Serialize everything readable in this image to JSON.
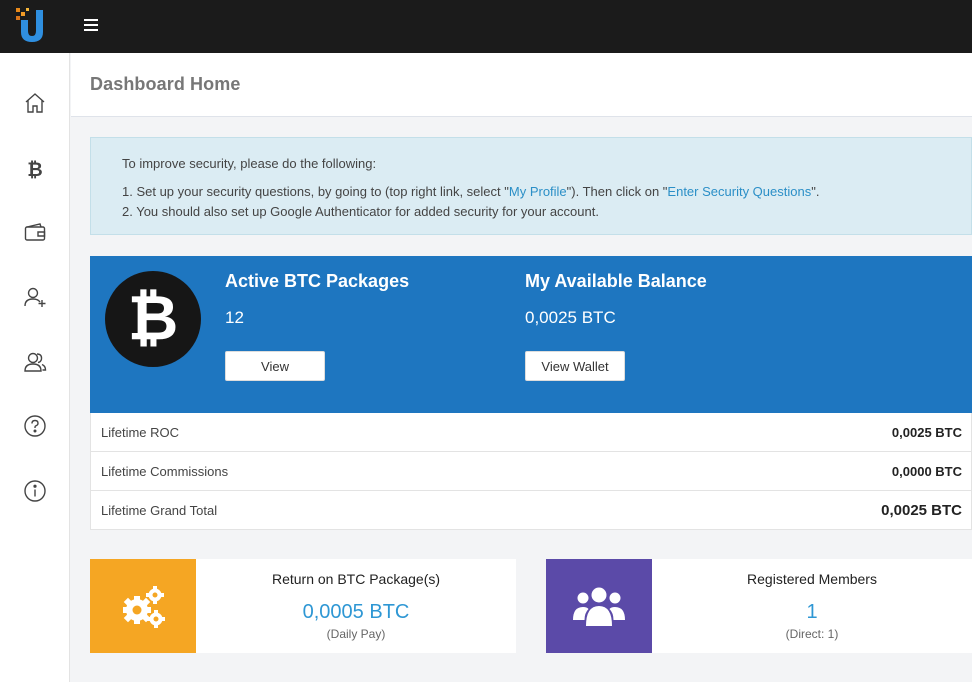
{
  "header": {
    "menu_icon": "hamburger-icon",
    "logo_icon": "u-logo-icon"
  },
  "sidebar": {
    "items": [
      {
        "name": "home",
        "icon": "home-icon"
      },
      {
        "name": "bitcoin",
        "icon": "bitcoin-icon"
      },
      {
        "name": "wallet",
        "icon": "wallet-icon"
      },
      {
        "name": "add-user",
        "icon": "add-user-icon"
      },
      {
        "name": "users",
        "icon": "users-icon"
      },
      {
        "name": "help",
        "icon": "help-icon"
      },
      {
        "name": "info",
        "icon": "info-icon"
      }
    ]
  },
  "page": {
    "title": "Dashboard Home"
  },
  "alert": {
    "intro": "To improve security, please do the following:",
    "line1_a": "1. Set up your security questions, by going to (top right link, select \"",
    "line1_link1": "My Profile",
    "line1_b": "\"). Then click on \"",
    "line1_link2": "Enter Security Questions",
    "line1_c": "\".",
    "line2": "2. You should also set up Google Authenticator for added security for your account."
  },
  "btc_panel": {
    "symbol": "₿",
    "packages_title": "Active BTC Packages",
    "packages_value": "12",
    "view_label": "View",
    "balance_title": "My Available Balance",
    "balance_value": "0,0025 BTC",
    "view_wallet_label": "View Wallet"
  },
  "stats": [
    {
      "label": "Lifetime ROC",
      "value": "0,0025 BTC"
    },
    {
      "label": "Lifetime Commissions",
      "value": "0,0000 BTC"
    },
    {
      "label": "Lifetime Grand Total",
      "value": "0,0025 BTC"
    }
  ],
  "cards": {
    "roi": {
      "title": "Return on BTC Package(s)",
      "value": "0,0005 BTC",
      "sub": "(Daily Pay)",
      "icon": "gears-icon",
      "color": "#f5a623"
    },
    "members": {
      "title": "Registered Members",
      "value": "1",
      "sub": "(Direct: 1)",
      "icon": "users-group-icon",
      "color": "#5b4aa8"
    }
  },
  "colors": {
    "primary": "#1e76c0",
    "link": "#2b8fc7",
    "alert_bg": "#dbecf3",
    "topbar": "#1b1b1b"
  }
}
